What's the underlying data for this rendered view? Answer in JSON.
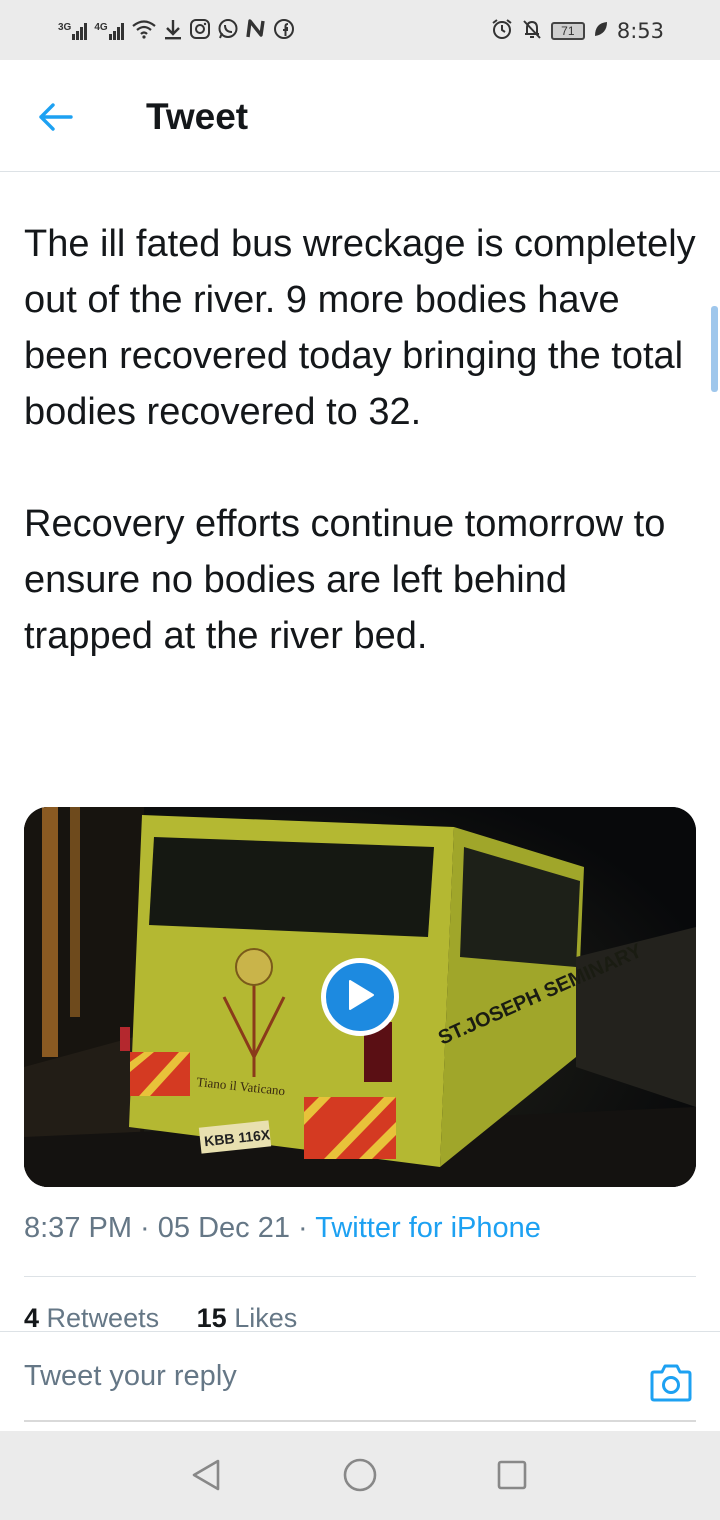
{
  "status_bar": {
    "network_1": "3G",
    "network_2": "4G",
    "battery": "71",
    "time": "8:53",
    "left_icons": [
      "signal-icon",
      "signal-icon",
      "wifi-icon",
      "download-icon",
      "instagram-icon",
      "whatsapp-icon",
      "n-icon",
      "facebook-icon"
    ],
    "right_icons": [
      "alarm-icon",
      "mute-icon",
      "battery-icon",
      "leaf-icon"
    ]
  },
  "header": {
    "title": "Tweet",
    "back_icon": "arrow-left-icon",
    "accent_color": "#1da1f2"
  },
  "tweet": {
    "text": "The ill fated bus wreckage is completely out of the river. 9 more bodies have been recovered today bringing the total bodies recovered to 32.\n\nRecovery efforts continue tomorrow to ensure no bodies are left behind trapped at the river bed.",
    "media": {
      "type": "video",
      "play_icon": "play-icon",
      "bus_lettering": "ST.JOSEPH SEMINARY",
      "bus_script": "Tiano il Vaticano",
      "plate": "KBB 116X"
    },
    "time": "8:37 PM",
    "date": "05 Dec 21",
    "source": "Twitter for iPhone",
    "retweets_count": "4",
    "retweets_label": "Retweets",
    "likes_count": "15",
    "likes_label": "Likes"
  },
  "reply": {
    "placeholder": "Tweet your reply",
    "camera_icon": "camera-icon"
  },
  "nav": {
    "back_icon": "triangle-back-icon",
    "home_icon": "circle-home-icon",
    "recents_icon": "square-recents-icon"
  }
}
